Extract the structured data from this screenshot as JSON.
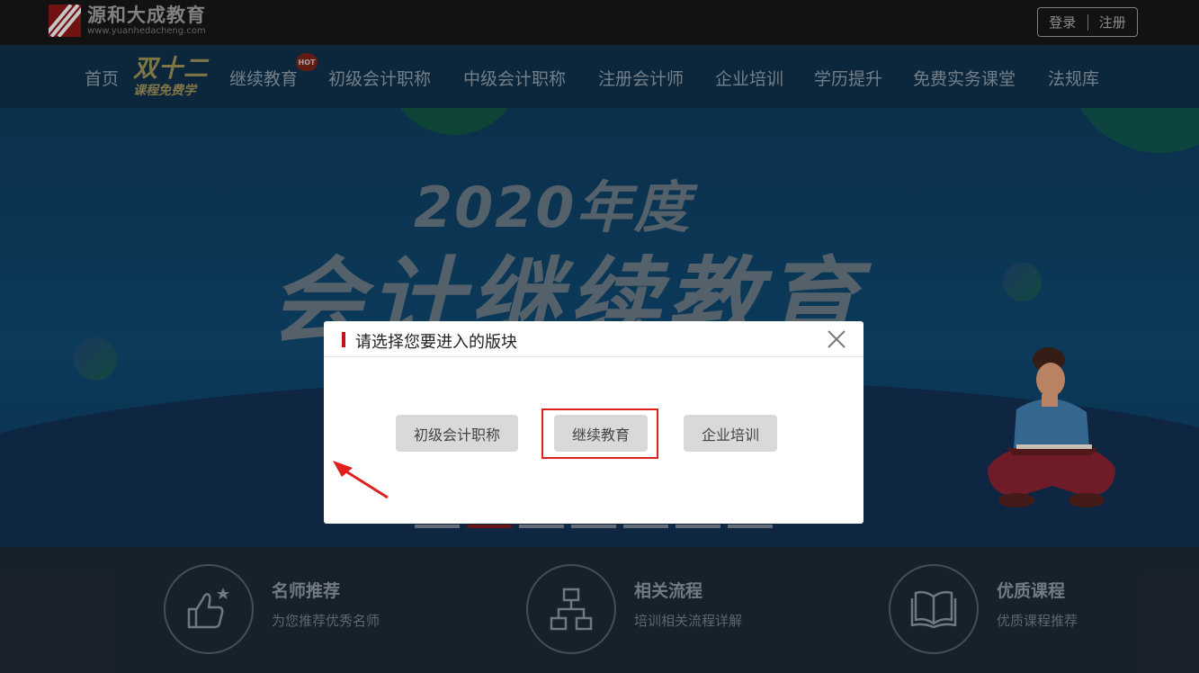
{
  "header": {
    "logo_name": "源和大成教育",
    "logo_url": "www.yuanhedacheng.com",
    "login": "登录",
    "register": "注册"
  },
  "nav": {
    "items": [
      "首页",
      "继续教育",
      "初级会计职称",
      "中级会计职称",
      "注册会计师",
      "企业培训",
      "学历提升",
      "免费实务课堂",
      "法规库"
    ],
    "promo_line1": "双十二",
    "promo_line2": "课程免费学",
    "hot_badge": "HOT"
  },
  "banner": {
    "headline_1": "2020年度",
    "headline_2": "会计继续教育",
    "slide_count": 7,
    "active_slide": 2
  },
  "features": [
    {
      "title": "名师推荐",
      "subtitle": "为您推荐优秀名师",
      "icon": "thumbs-up-star-icon"
    },
    {
      "title": "相关流程",
      "subtitle": "培训相关流程详解",
      "icon": "flowchart-icon"
    },
    {
      "title": "优质课程",
      "subtitle": "优质课程推荐",
      "icon": "open-book-icon"
    }
  ],
  "modal": {
    "title": "请选择您要进入的版块",
    "options": [
      "初级会计职称",
      "继续教育",
      "企业培训"
    ],
    "highlighted_option": "继续教育"
  },
  "colors": {
    "accent_red": "#c3121c",
    "highlight_red": "#e0201f",
    "modal_button": "#d9d9d9"
  }
}
